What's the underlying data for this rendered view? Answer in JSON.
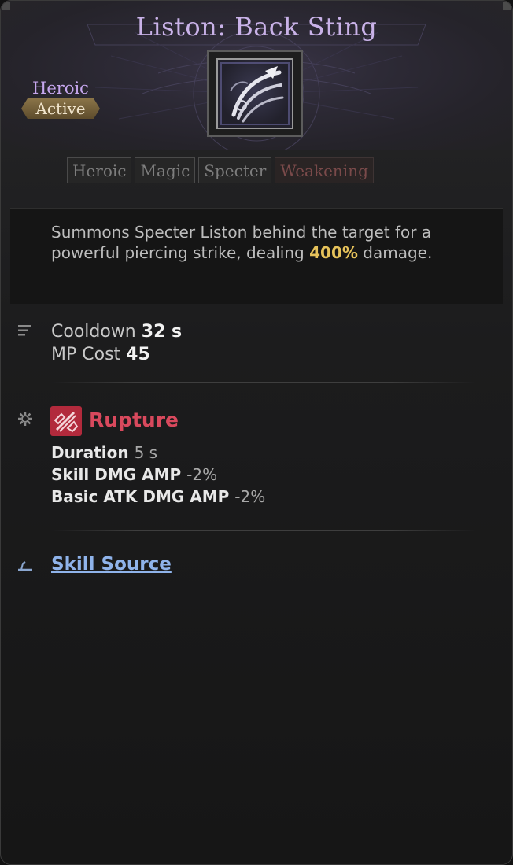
{
  "skill": {
    "name": "Liston: Back Sting",
    "grade": "Heroic",
    "type": "Active",
    "icon": "specter-claw-icon"
  },
  "tags": [
    "Heroic",
    "Magic",
    "Specter",
    "Weakening"
  ],
  "description": {
    "text_before": "Summons Specter Liston behind the target for a powerful piercing strike, dealing ",
    "highlight": "400%",
    "text_after": " damage."
  },
  "stats": {
    "cooldown_label": "Cooldown",
    "cooldown_value": "32 s",
    "mp_label": "MP Cost",
    "mp_value": "45"
  },
  "effect": {
    "name": "Rupture",
    "icon": "rupture-icon",
    "lines": [
      {
        "label": "Duration",
        "value": "5 s"
      },
      {
        "label": "Skill DMG AMP",
        "value": "-2%"
      },
      {
        "label": "Basic ATK DMG AMP",
        "value": "-2%"
      }
    ]
  },
  "source": {
    "label": "Skill Source"
  },
  "colors": {
    "title": "#c9b2e8",
    "grade": "#c6a6ee",
    "highlight": "#e6c25a",
    "effect": "#d9495d",
    "link": "#8fb3ea"
  }
}
